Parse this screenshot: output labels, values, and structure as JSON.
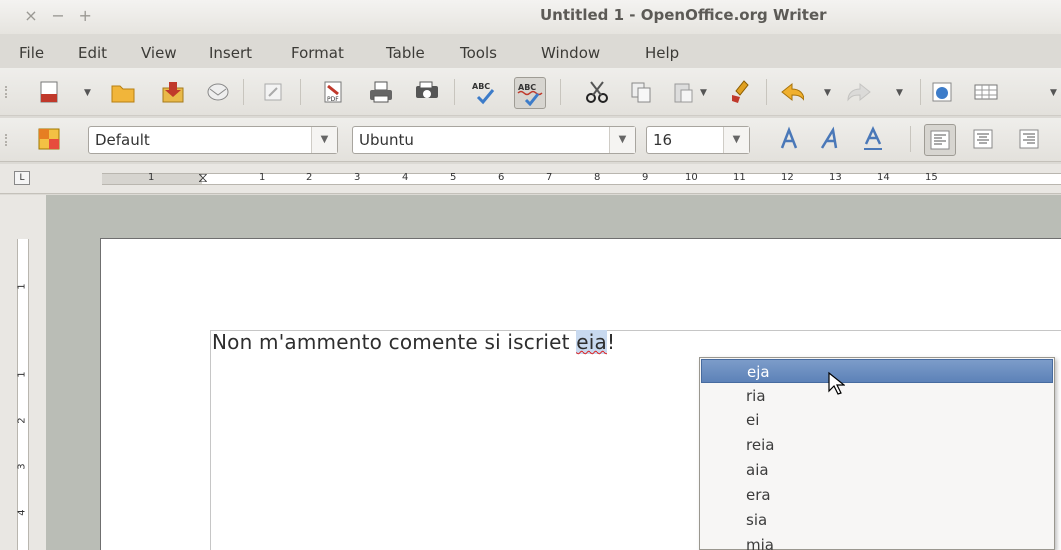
{
  "window": {
    "title": "Untitled 1 - OpenOffice.org Writer",
    "controls": [
      "×",
      "−",
      "+"
    ]
  },
  "menu": [
    "File",
    "Edit",
    "View",
    "Insert",
    "Format",
    "Table",
    "Tools",
    "Window",
    "Help"
  ],
  "toolbar_formatting": {
    "style": "Default",
    "font": "Ubuntu",
    "size": "16"
  },
  "ruler": {
    "horizontal_ticks": [
      "1",
      "1",
      "2",
      "3",
      "4",
      "5",
      "6",
      "7",
      "8",
      "9",
      "10",
      "11",
      "12",
      "13",
      "14",
      "15"
    ],
    "vertical_ticks": [
      "1",
      "1",
      "2",
      "3",
      "4"
    ],
    "corner_label": "L"
  },
  "document": {
    "text_before": "Non m'ammento comente si iscriet ",
    "misspelled_word": "eia",
    "text_after": "!"
  },
  "context_menu": {
    "items": [
      "eja",
      "ria",
      "ei",
      "reia",
      "aia",
      "era",
      "sia",
      "mia"
    ],
    "selected_index": 0
  },
  "colors": {
    "selection": "#5d82b8",
    "spell_error": "#d22222"
  }
}
